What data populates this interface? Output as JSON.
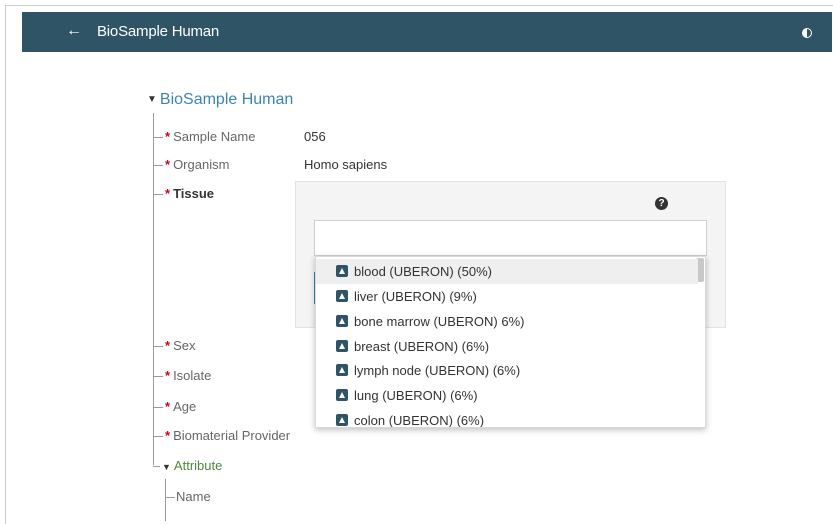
{
  "header": {
    "back_icon": "arrow-left-icon",
    "title": "BioSample Human",
    "contrast_icon": "contrast-icon"
  },
  "form": {
    "section_title": "BioSample Human",
    "fields": [
      {
        "label": "Sample Name",
        "required": "*",
        "value": "056"
      },
      {
        "label": "Organism",
        "required": "*",
        "value": "Homo sapiens"
      },
      {
        "label": "Tissue",
        "required": "*"
      },
      {
        "label": "Sex",
        "required": "*"
      },
      {
        "label": "Isolate",
        "required": "*"
      },
      {
        "label": "Age",
        "required": "*"
      },
      {
        "label": "Biomaterial Provider",
        "required": "*"
      }
    ],
    "attribute": {
      "label": "Attribute",
      "child": "Name"
    }
  },
  "tissue": {
    "help_icon": "?",
    "input_value": "",
    "suggestions": [
      "blood (UBERON) (50%)",
      "liver (UBERON) (9%)",
      "bone marrow (UBERON) 6%)",
      "breast (UBERON) (6%)",
      "lymph node (UBERON) (6%)",
      "lung (UBERON) (6%)",
      "colon (UBERON) (6%)"
    ]
  },
  "colors": {
    "header_bg": "#2f5466",
    "link": "#3b84b8",
    "required": "#d0021b",
    "attribute": "#4a8a3b"
  }
}
